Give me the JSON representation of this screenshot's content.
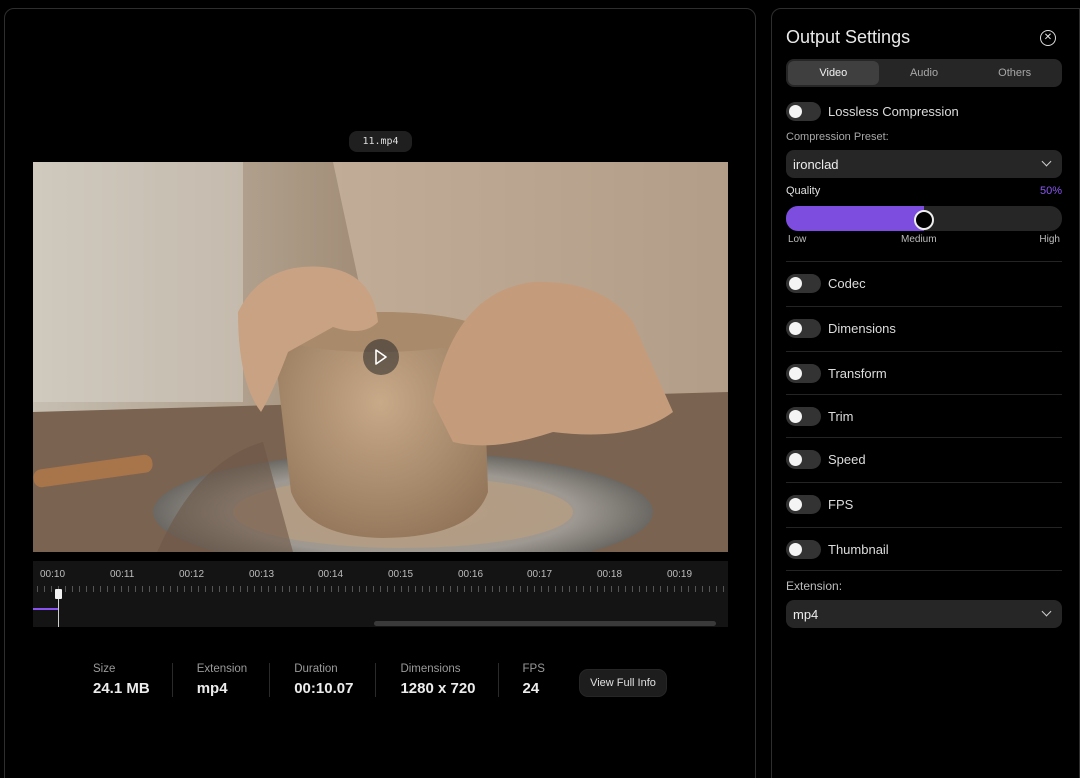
{
  "preview": {
    "filename": "11.mp4"
  },
  "timeline": {
    "ticks": [
      "00:10",
      "00:11",
      "00:12",
      "00:13",
      "00:14",
      "00:15",
      "00:16",
      "00:17",
      "00:18",
      "00:19"
    ]
  },
  "file_info": {
    "items": [
      {
        "label": "Size",
        "value": "24.1 MB"
      },
      {
        "label": "Extension",
        "value": "mp4"
      },
      {
        "label": "Duration",
        "value": "00:10.07"
      },
      {
        "label": "Dimensions",
        "value": "1280 x 720"
      },
      {
        "label": "FPS",
        "value": "24"
      }
    ],
    "view_full_info_label": "View Full Info"
  },
  "output_settings": {
    "title": "Output Settings",
    "tabs": [
      {
        "label": "Video",
        "active": true
      },
      {
        "label": "Audio",
        "active": false
      },
      {
        "label": "Others",
        "active": false
      }
    ],
    "lossless_label": "Lossless Compression",
    "compression_preset_label": "Compression Preset:",
    "compression_preset_value": "ironclad",
    "quality_label": "Quality",
    "quality_percent_text": "50%",
    "quality_value": 0.5,
    "quality_scale": {
      "low": "Low",
      "medium": "Medium",
      "high": "High"
    },
    "toggles": [
      {
        "label": "Codec",
        "on": false
      },
      {
        "label": "Dimensions",
        "on": false
      },
      {
        "label": "Transform",
        "on": false
      },
      {
        "label": "Trim",
        "on": false
      },
      {
        "label": "Speed",
        "on": false
      },
      {
        "label": "FPS",
        "on": false
      },
      {
        "label": "Thumbnail",
        "on": false
      }
    ],
    "extension_label": "Extension:",
    "extension_value": "mp4"
  },
  "colors": {
    "accent": "#7c4ddf",
    "accent_text": "#8b57f5"
  }
}
